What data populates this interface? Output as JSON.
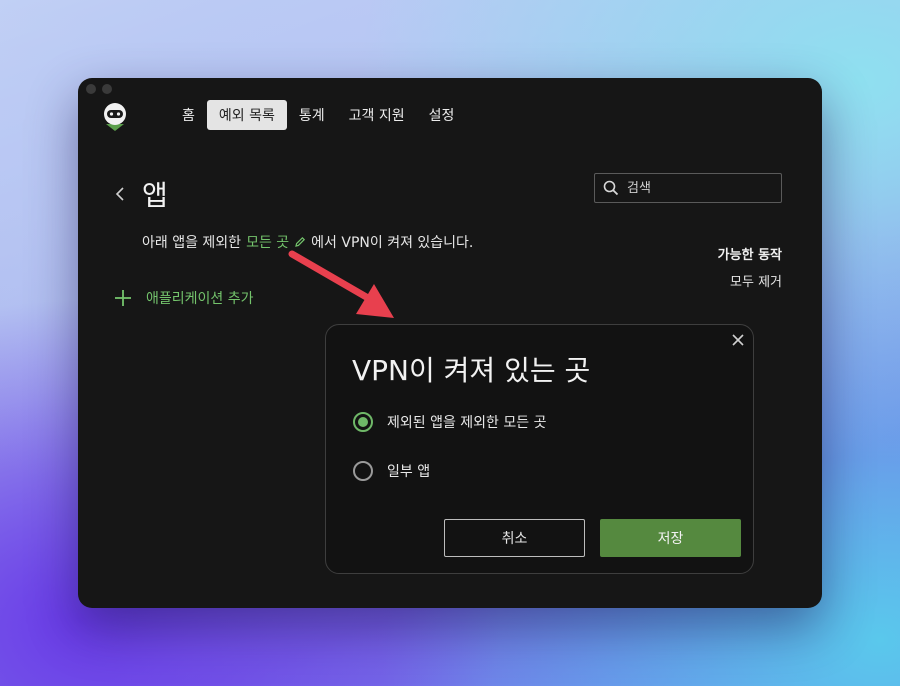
{
  "nav": {
    "items": [
      {
        "label": "홈",
        "active": false
      },
      {
        "label": "예외 목록",
        "active": true
      },
      {
        "label": "통계",
        "active": false
      },
      {
        "label": "고객 지원",
        "active": false
      },
      {
        "label": "설정",
        "active": false
      }
    ]
  },
  "page": {
    "title": "앱",
    "search_placeholder": "검색",
    "description_before": "아래 앱을 제외한",
    "description_link": "모든 곳",
    "description_after": "에서 VPN이 켜져 있습니다.",
    "actions_title": "가능한 동작",
    "remove_all_label": "모두 제거",
    "add_app_label": "애플리케이션 추가"
  },
  "modal": {
    "title": "VPN이 켜져 있는 곳",
    "options": [
      {
        "label": "제외된 앱을 제외한 모든 곳",
        "selected": true
      },
      {
        "label": "일부 앱",
        "selected": false
      }
    ],
    "cancel_label": "취소",
    "save_label": "저장"
  },
  "colors": {
    "accent_green": "#74c46c",
    "save_button": "#55893f",
    "arrow_red": "#e8404e",
    "window_bg": "#161616"
  },
  "icons": [
    "logo-icon",
    "back-chevron-icon",
    "search-icon",
    "edit-pencil-icon",
    "plus-icon",
    "close-icon",
    "annotation-arrow"
  ]
}
